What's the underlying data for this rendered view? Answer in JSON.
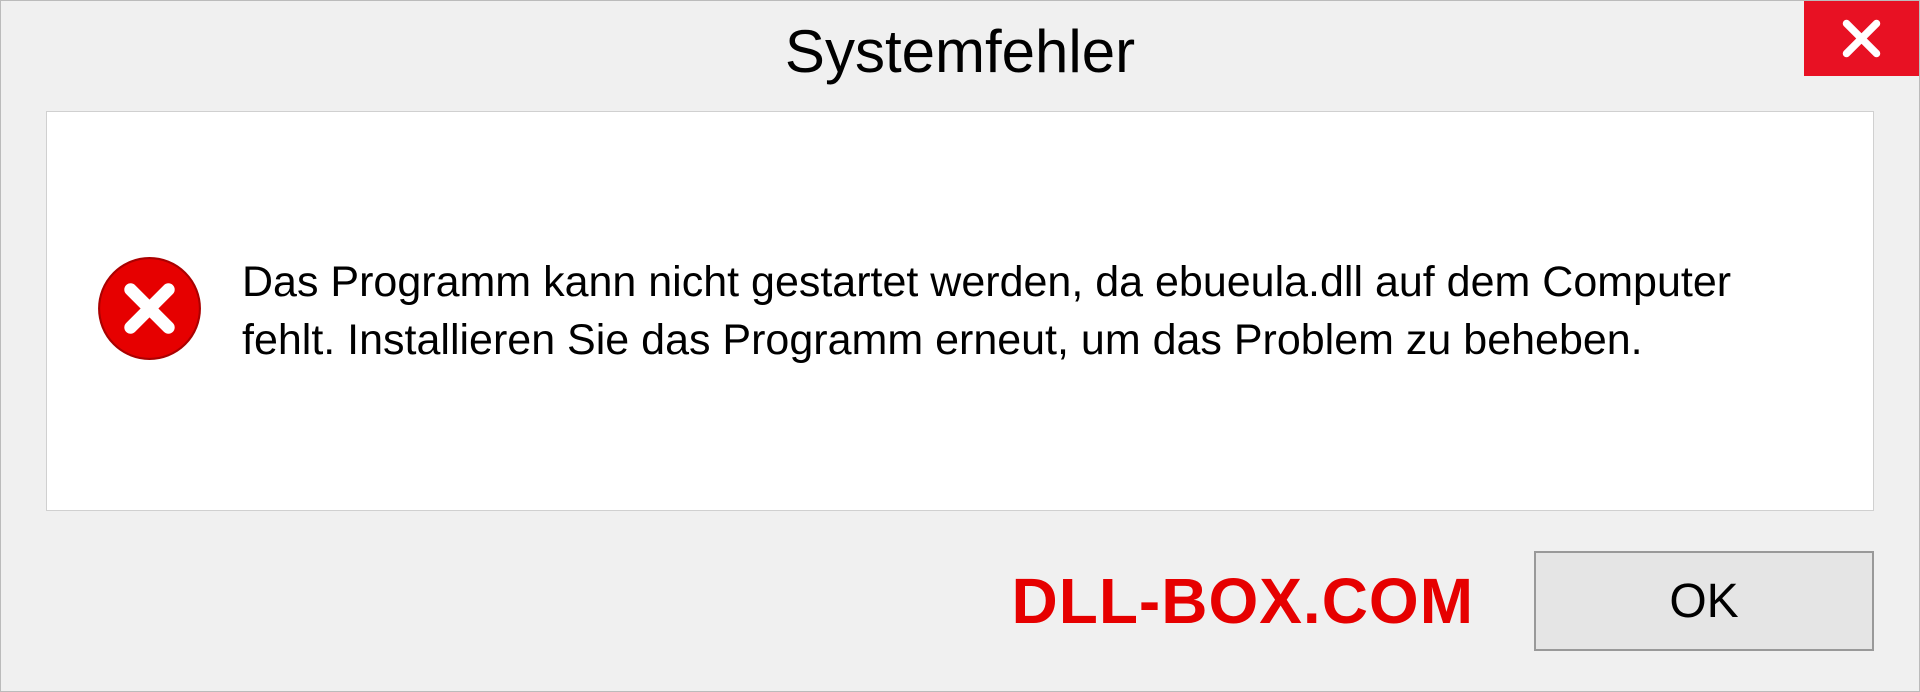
{
  "dialog": {
    "title": "Systemfehler",
    "message": "Das Programm kann nicht gestartet werden, da ebueula.dll auf dem Computer fehlt. Installieren Sie das Programm erneut, um das Problem zu beheben.",
    "ok_label": "OK"
  },
  "watermark": "DLL-BOX.COM"
}
